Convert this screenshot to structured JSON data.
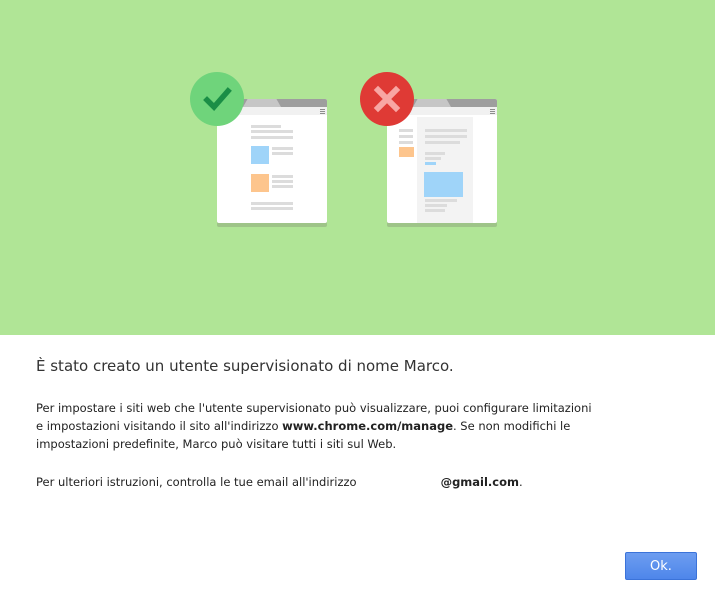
{
  "illustration": {
    "allowed_badge_icon": "checkmark-icon",
    "blocked_badge_icon": "cross-icon",
    "colors": {
      "banner": "#b0e596",
      "allowed_badge": "#6fd47b",
      "allowed_mark": "#1a8e46",
      "blocked_badge": "#df3a35",
      "blocked_mark": "#f8a6a3",
      "blue_block": "#9fd4f9",
      "orange_block": "#fdc58d"
    }
  },
  "dialog": {
    "title": "È stato creato un utente supervisionato di nome Marco.",
    "paragraph1": {
      "before": "Per impostare i siti web che l'utente supervisionato può visualizzare, puoi configurare limitazioni e impostazioni visitando il sito all'indirizzo ",
      "link": "www.chrome.com/manage",
      "after": ". Se non modifichi le impostazioni predefinite, Marco può visitare tutti i siti sul Web."
    },
    "paragraph2": {
      "before": "Per ulteriori istruzioni, controlla le tue email all'indirizzo",
      "email": "@gmail.com",
      "after": "."
    },
    "ok_label": "Ok."
  }
}
